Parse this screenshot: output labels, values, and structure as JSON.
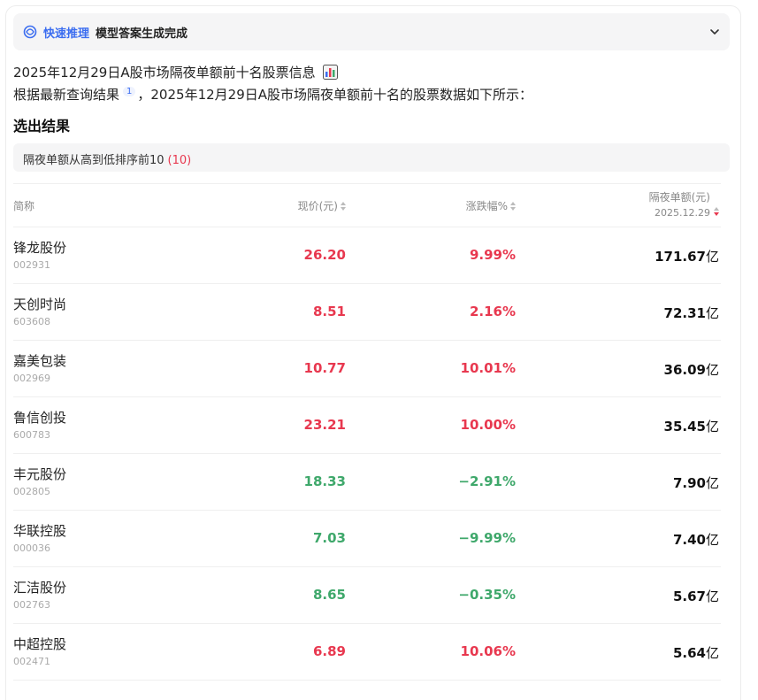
{
  "banner": {
    "mode_label": "快速推理",
    "status_label": "模型答案生成完成",
    "colors": {
      "accent": "#3b6df0"
    }
  },
  "intro": {
    "heading": "2025年12月29日A股市场隔夜单额前十名股票信息",
    "heading_icon": "bar-chart-icon",
    "text_before_cite": "根据最新查询结果",
    "citation": "1",
    "text_after_cite": "，2025年12月29日A股市场隔夜单额前十名的股票数据如下所示："
  },
  "result": {
    "title": "选出结果",
    "filter_text": "隔夜单额从高到低排序前10",
    "filter_count": "(10)"
  },
  "table": {
    "headers": {
      "name": "简称",
      "price": "现价(元)",
      "change": "涨跌幅%",
      "amount": "隔夜单额(元)",
      "amount_date": "2025.12.29"
    },
    "colors": {
      "up": "#e8384f",
      "down": "#3fa86b"
    },
    "rows": [
      {
        "name": "锋龙股份",
        "code": "002931",
        "price": "26.20",
        "change": "9.99%",
        "amount": "171.67",
        "unit": "亿",
        "trend": "up"
      },
      {
        "name": "天创时尚",
        "code": "603608",
        "price": "8.51",
        "change": "2.16%",
        "amount": "72.31",
        "unit": "亿",
        "trend": "up"
      },
      {
        "name": "嘉美包装",
        "code": "002969",
        "price": "10.77",
        "change": "10.01%",
        "amount": "36.09",
        "unit": "亿",
        "trend": "up"
      },
      {
        "name": "鲁信创投",
        "code": "600783",
        "price": "23.21",
        "change": "10.00%",
        "amount": "35.45",
        "unit": "亿",
        "trend": "up"
      },
      {
        "name": "丰元股份",
        "code": "002805",
        "price": "18.33",
        "change": "−2.91%",
        "amount": "7.90",
        "unit": "亿",
        "trend": "down"
      },
      {
        "name": "华联控股",
        "code": "000036",
        "price": "7.03",
        "change": "−9.99%",
        "amount": "7.40",
        "unit": "亿",
        "trend": "down"
      },
      {
        "name": "汇洁股份",
        "code": "002763",
        "price": "8.65",
        "change": "−0.35%",
        "amount": "5.67",
        "unit": "亿",
        "trend": "down"
      },
      {
        "name": "中超控股",
        "code": "002471",
        "price": "6.89",
        "change": "10.06%",
        "amount": "5.64",
        "unit": "亿",
        "trend": "up"
      }
    ]
  }
}
